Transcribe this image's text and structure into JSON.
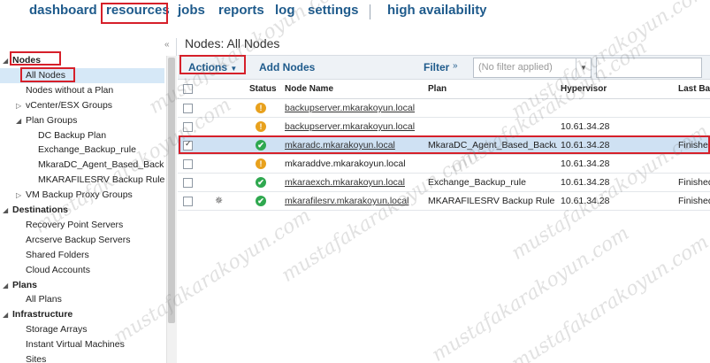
{
  "topnav": {
    "items": [
      "dashboard",
      "resources",
      "jobs",
      "reports",
      "log",
      "settings",
      "high availability"
    ]
  },
  "sidebar": {
    "collapse_icon": "double-chevron-left",
    "tree": [
      {
        "label": "Nodes",
        "level": 0,
        "section": true,
        "caret": "down"
      },
      {
        "label": "All Nodes",
        "level": 1,
        "selected": true
      },
      {
        "label": "Nodes without a Plan",
        "level": 1
      },
      {
        "label": "vCenter/ESX Groups",
        "level": 1,
        "caret": "right"
      },
      {
        "label": "Plan Groups",
        "level": 1,
        "caret": "down"
      },
      {
        "label": "DC Backup Plan",
        "level": 2
      },
      {
        "label": "Exchange_Backup_rule",
        "level": 2
      },
      {
        "label": "MkaraDC_Agent_Based_Backup_",
        "level": 2
      },
      {
        "label": "MKARAFILESRV Backup Rule",
        "level": 2
      },
      {
        "label": "VM Backup Proxy Groups",
        "level": 1,
        "caret": "right"
      },
      {
        "label": "Destinations",
        "level": 0,
        "section": true,
        "caret": "down"
      },
      {
        "label": "Recovery Point Servers",
        "level": 1
      },
      {
        "label": "Arcserve Backup Servers",
        "level": 1
      },
      {
        "label": "Shared Folders",
        "level": 1
      },
      {
        "label": "Cloud Accounts",
        "level": 1
      },
      {
        "label": "Plans",
        "level": 0,
        "section": true,
        "caret": "down"
      },
      {
        "label": "All Plans",
        "level": 1
      },
      {
        "label": "Infrastructure",
        "level": 0,
        "section": true,
        "caret": "down"
      },
      {
        "label": "Storage Arrays",
        "level": 1
      },
      {
        "label": "Instant Virtual Machines",
        "level": 1
      },
      {
        "label": "Sites",
        "level": 1
      }
    ]
  },
  "main": {
    "title": "Nodes: All Nodes",
    "toolbar": {
      "actions_label": "Actions",
      "add_nodes_label": "Add Nodes",
      "filter_label": "Filter",
      "filter_placeholder": "(No filter applied)",
      "search_value": ""
    },
    "columns": [
      "Status",
      "Node Name",
      "Plan",
      "Hypervisor",
      "Last Bac"
    ],
    "rows": [
      {
        "checked": false,
        "spinner": false,
        "status": "warn",
        "name": "backupserver.mkarakoyun.local",
        "name_link": true,
        "plan": "",
        "hypervisor": "",
        "last_backup": ""
      },
      {
        "checked": false,
        "spinner": false,
        "status": "warn",
        "name": "backupserver.mkarakoyun.local",
        "name_link": true,
        "plan": "",
        "hypervisor": "10.61.34.28",
        "last_backup": ""
      },
      {
        "checked": true,
        "spinner": false,
        "status": "ok",
        "name": "mkaradc.mkarakoyun.local",
        "name_link": true,
        "plan": "MkaraDC_Agent_Based_Backup_",
        "hypervisor": "10.61.34.28",
        "last_backup": "Finished"
      },
      {
        "checked": false,
        "spinner": false,
        "status": "warn",
        "name": "mkaraddve.mkarakoyun.local",
        "name_link": false,
        "plan": "",
        "hypervisor": "10.61.34.28",
        "last_backup": ""
      },
      {
        "checked": false,
        "spinner": false,
        "status": "ok",
        "name": "mkaraexch.mkarakoyun.local",
        "name_link": true,
        "plan": "Exchange_Backup_rule",
        "hypervisor": "10.61.34.28",
        "last_backup": "Finished"
      },
      {
        "checked": false,
        "spinner": true,
        "status": "ok",
        "name": "mkarafilesrv.mkarakoyun.local",
        "name_link": true,
        "plan": "MKARAFILESRV Backup Rule",
        "hypervisor": "10.61.34.28",
        "last_backup": "Finished"
      }
    ]
  },
  "colors": {
    "accent": "#1f5b8c",
    "selection": "#cfe1f3",
    "highlight_box": "#d6202a",
    "status_ok": "#2fa84f",
    "status_warn": "#e8a11d"
  },
  "watermark_text": "mustafakarakoyun.com"
}
